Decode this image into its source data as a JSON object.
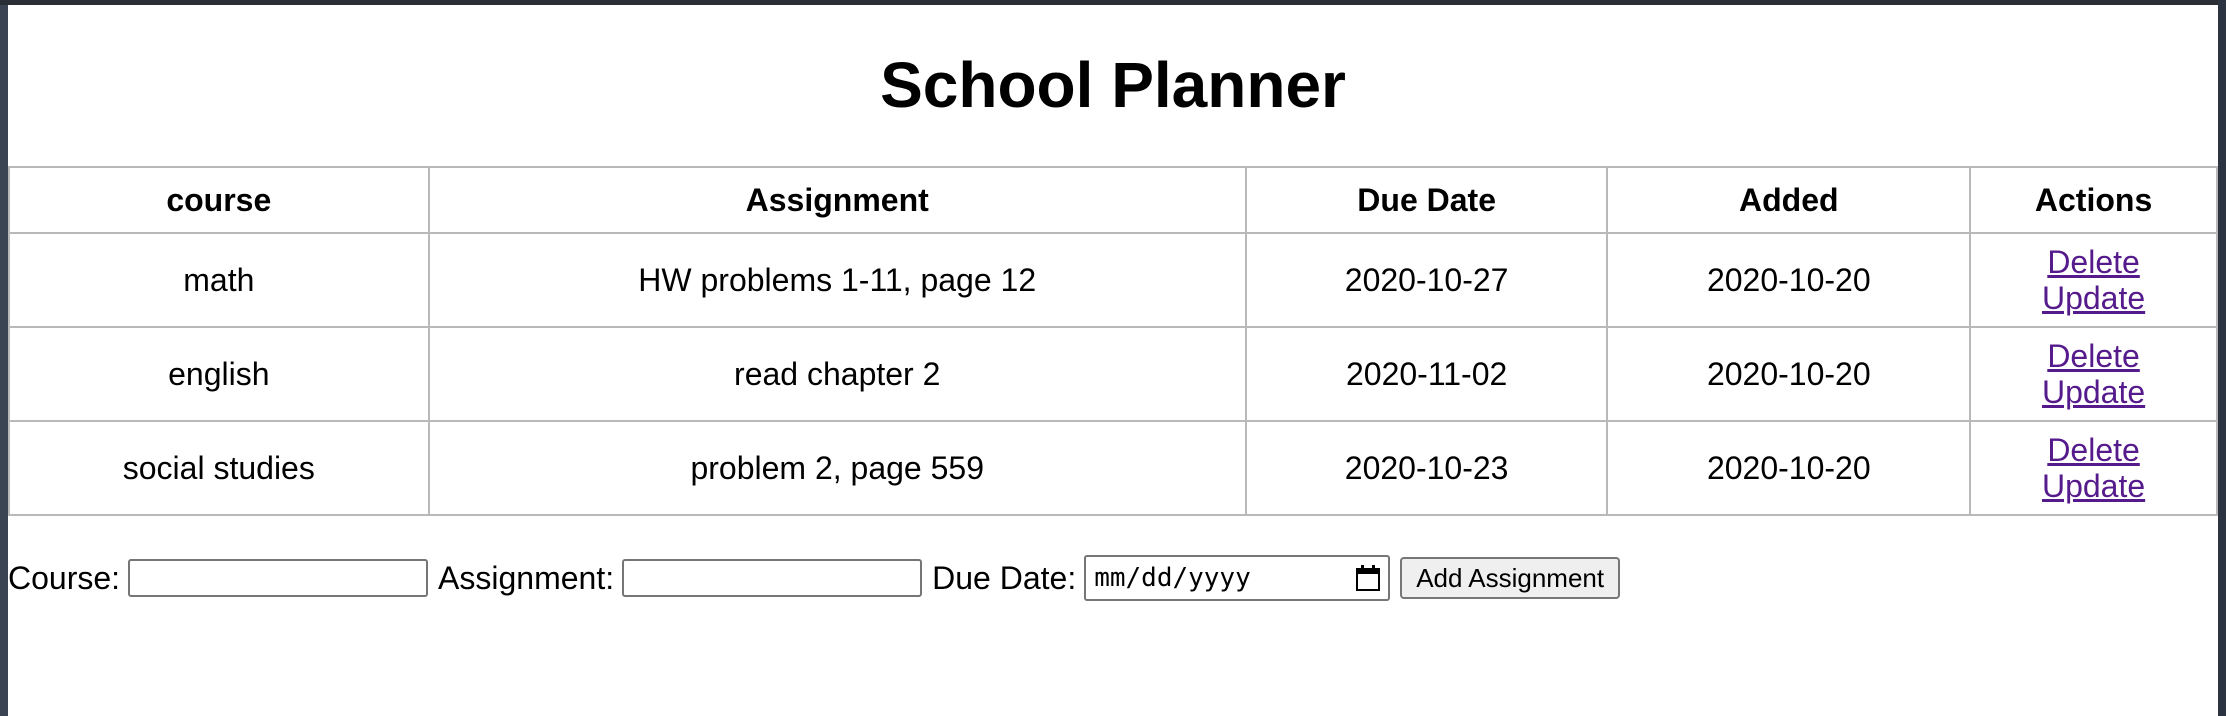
{
  "page": {
    "title": "School Planner"
  },
  "table": {
    "headers": [
      "course",
      "Assignment",
      "Due Date",
      "Added",
      "Actions"
    ],
    "rows": [
      {
        "course": "math",
        "assignment": "HW problems 1-11, page 12",
        "due": "2020-10-27",
        "added": "2020-10-20",
        "delete": "Delete",
        "update": "Update"
      },
      {
        "course": "english",
        "assignment": "read chapter 2",
        "due": "2020-11-02",
        "added": "2020-10-20",
        "delete": "Delete",
        "update": "Update"
      },
      {
        "course": "social studies",
        "assignment": "problem 2, page 559",
        "due": "2020-10-23",
        "added": "2020-10-20",
        "delete": "Delete",
        "update": "Update"
      }
    ]
  },
  "form": {
    "course_label": "Course:",
    "course_value": "",
    "assignment_label": "Assignment:",
    "assignment_value": "",
    "due_label": "Due Date:",
    "due_placeholder": "mm/dd/yyyy",
    "due_icon": "calendar-icon",
    "submit_label": "Add Assignment"
  },
  "colors": {
    "link": "#551a8b",
    "border": "#b9b9b9"
  }
}
